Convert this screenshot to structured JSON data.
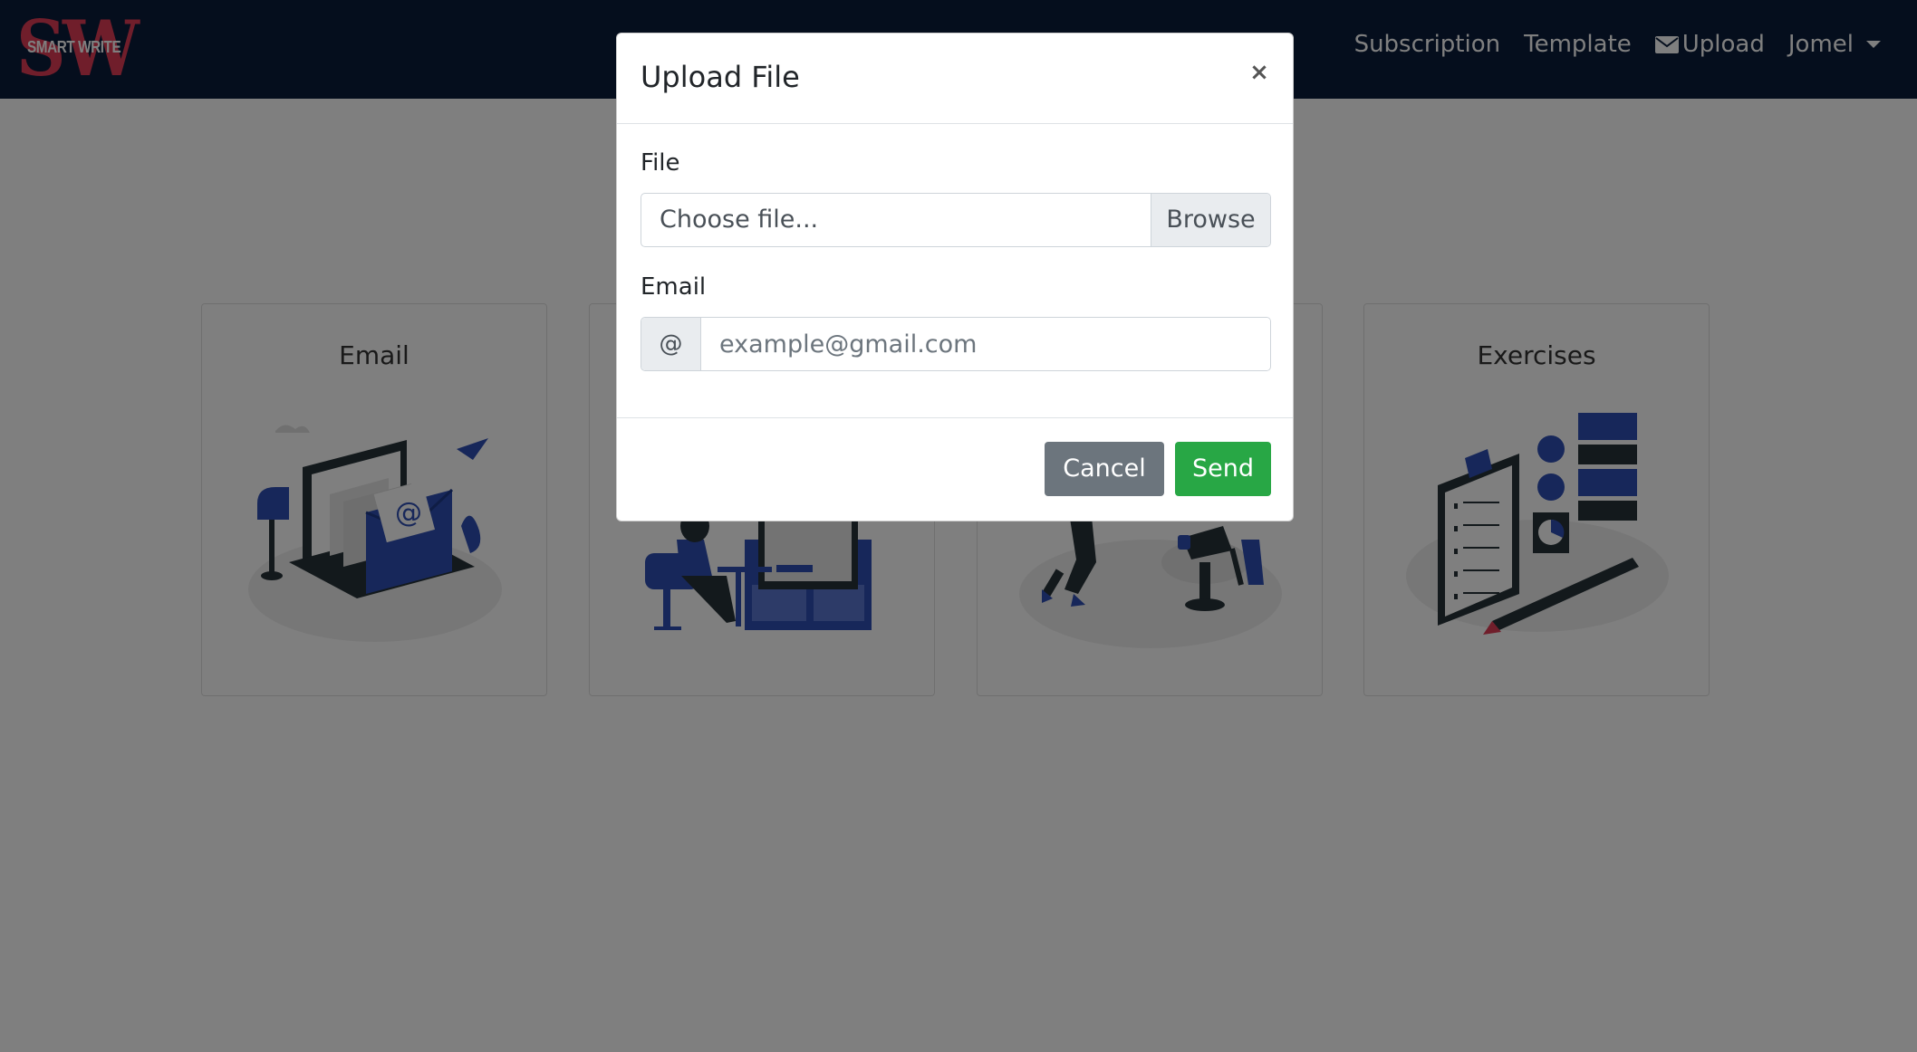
{
  "brand": {
    "logo_letters": "SW",
    "logo_text": "SMART WRITE"
  },
  "nav": {
    "subscription": "Subscription",
    "template": "Template",
    "upload": "Upload",
    "user": "Jomel"
  },
  "cards": [
    {
      "title": "Email",
      "icon": "email-illustration"
    },
    {
      "title": "",
      "icon": "publishing-illustration"
    },
    {
      "title": "",
      "icon": "activity-illustration"
    },
    {
      "title": "Exercises",
      "icon": "exercises-illustration"
    }
  ],
  "modal": {
    "title": "Upload File",
    "close_label": "×",
    "file_label": "File",
    "file_placeholder": "Choose file...",
    "browse_label": "Browse",
    "email_label": "Email",
    "email_addon": "@",
    "email_placeholder": "example@gmail.com",
    "cancel_label": "Cancel",
    "send_label": "Send"
  },
  "colors": {
    "navbar": "#0a1c3a",
    "accent": "#2f4fb5",
    "send": "#28a745",
    "cancel": "#6c757d",
    "logo": "#e03c56"
  }
}
